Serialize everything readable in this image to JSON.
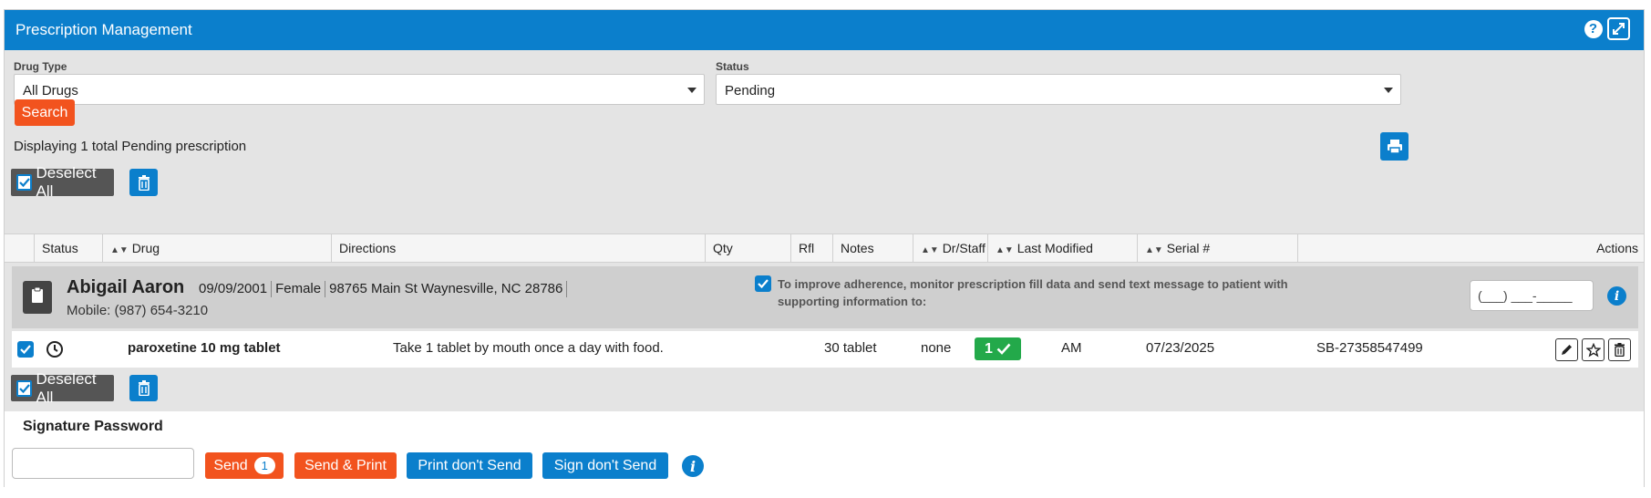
{
  "header": {
    "title": "Prescription Management",
    "help_icon": "?"
  },
  "filters": {
    "drug_type_label": "Drug Type",
    "drug_type_value": "All Drugs",
    "status_label": "Status",
    "status_value": "Pending",
    "search_label": "Search"
  },
  "summary": "Displaying 1 total Pending prescription",
  "bulk": {
    "deselect_all": "Deselect All"
  },
  "table": {
    "columns": {
      "status": "Status",
      "drug": "Drug",
      "directions": "Directions",
      "qty": "Qty",
      "rfl": "Rfl",
      "notes": "Notes",
      "dr_staff": "Dr/Staff",
      "last_modified": "Last Modified",
      "serial": "Serial #",
      "actions": "Actions"
    },
    "patient": {
      "name": "Abigail Aaron",
      "dob": "09/09/2001",
      "gender": "Female",
      "address": "98765 Main St Waynesville, NC 28786",
      "mobile": "Mobile: (987) 654-3210",
      "adherence_text": "To improve adherence, monitor prescription fill data and send text message to patient with supporting information to:",
      "phone_placeholder": "(___) ___-_____"
    },
    "rows": [
      {
        "drug": "paroxetine 10 mg tablet",
        "directions": "Take 1 tablet by mouth once a day with food.",
        "qty": "30 tablet",
        "rfl": "none",
        "notes": "1",
        "dr_staff": "AM",
        "last_modified": "07/23/2025",
        "serial": "SB-27358547499"
      }
    ]
  },
  "signature": {
    "label": "Signature Password",
    "send": "Send",
    "send_count": "1",
    "send_print": "Send & Print",
    "print_dont_send": "Print don't Send",
    "sign_dont_send": "Sign don't Send"
  },
  "colors": {
    "primary": "#0b7fcc",
    "accent": "#f2531e",
    "success": "#23a94a",
    "dark_button": "#555555",
    "panel_bg": "#e4e4e4"
  }
}
